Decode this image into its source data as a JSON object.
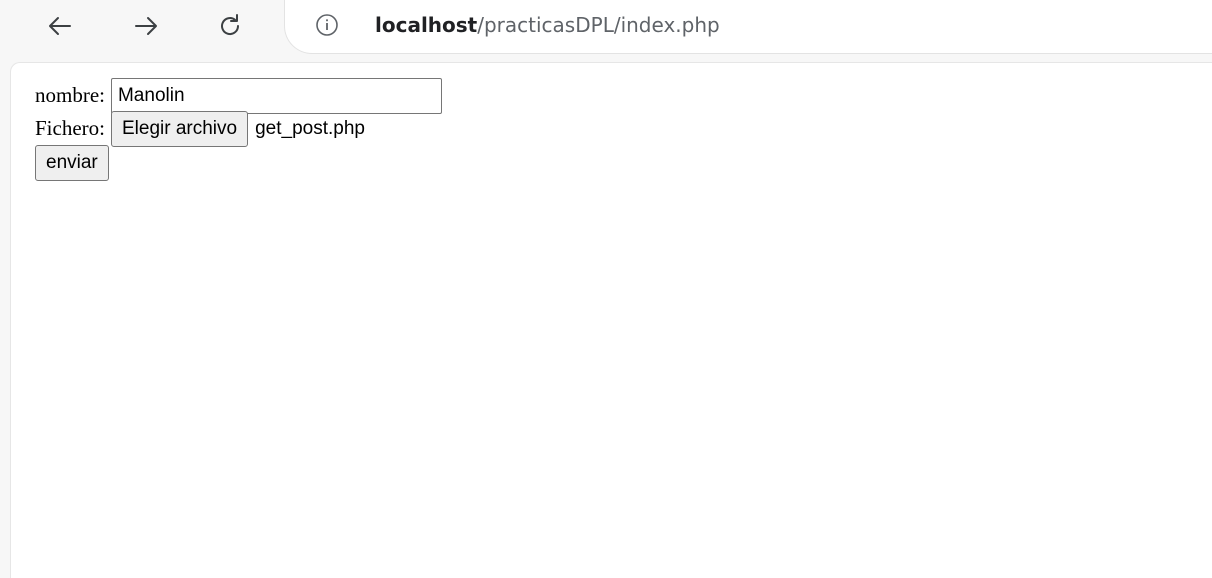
{
  "browser": {
    "url_host": "localhost",
    "url_path": "/practicasDPL/index.php",
    "icons": {
      "back": "arrow-left-icon",
      "forward": "arrow-right-icon",
      "reload": "reload-icon",
      "info": "info-icon"
    }
  },
  "form": {
    "name_label": "nombre:",
    "name_value": "Manolin",
    "file_label": "Fichero:",
    "file_button_label": "Elegir archivo",
    "file_name": "get_post.php",
    "submit_label": "enviar"
  }
}
